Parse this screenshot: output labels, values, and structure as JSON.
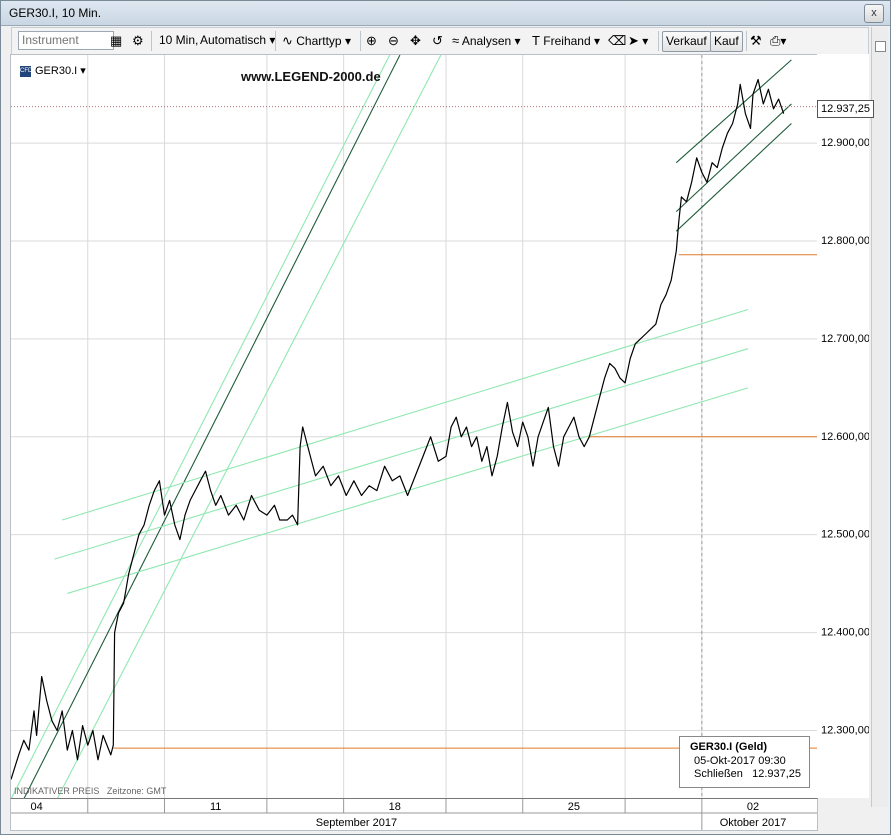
{
  "window": {
    "title": "GER30.I, 10 Min.",
    "close_label": "x"
  },
  "toolbar": {
    "instrument_placeholder": "Instrument",
    "interval_label": "10 Min,",
    "mode_label": "Automatisch",
    "charttyp_label": "Charttyp",
    "analysen_label": "Analysen",
    "freihand_label": "Freihand",
    "verkauf_label": "Verkauf",
    "kauf_label": "Kauf"
  },
  "chart_header": {
    "symbol": "GER30.I",
    "cfd_badge": "CFD",
    "watermark": "www.LEGEND-2000.de"
  },
  "footer": {
    "price_type": "INDIKATIVER PREIS",
    "timezone": "Zeitzone: GMT"
  },
  "current_price_label": "12.937,25",
  "infobox": {
    "title": "GER30.I (Geld)",
    "datetime": "05-Okt-2017 09:30",
    "close_label": "Schließen",
    "close_value": "12.937,25"
  },
  "colors": {
    "price_line": "#000000",
    "channel_dark": "#1f5c3a",
    "channel_light": "#8fe8b0",
    "support": "#e07a2a",
    "current_dotted": "#b07070",
    "grid": "#d9d9d9"
  },
  "chart_data": {
    "type": "line",
    "instrument": "GER30.I",
    "interval": "10 Min.",
    "yticks": [
      {
        "value": 12900,
        "label": "12.900,00"
      },
      {
        "value": 12800,
        "label": "12.800,00"
      },
      {
        "value": 12700,
        "label": "12.700,00"
      },
      {
        "value": 12600,
        "label": "12.600,00"
      },
      {
        "value": 12500,
        "label": "12.500,00"
      },
      {
        "value": 12400,
        "label": "12.400,00"
      },
      {
        "value": 12300,
        "label": "12.300,00"
      }
    ],
    "ylim": [
      12230,
      12990
    ],
    "xlim": [
      0,
      31.5
    ],
    "xticks": [
      {
        "t": 1.0,
        "label": "04"
      },
      {
        "t": 8.0,
        "label": "11"
      },
      {
        "t": 15.0,
        "label": "18"
      },
      {
        "t": 22.0,
        "label": "25"
      },
      {
        "t": 29.0,
        "label": "02"
      }
    ],
    "month_labels": [
      {
        "t": 13.5,
        "label": "September 2017"
      },
      {
        "t": 29.0,
        "label": "Oktober 2017"
      }
    ],
    "period_separators": [
      3.0,
      6.0,
      10.0,
      13.0,
      17.0,
      20.0,
      24.0,
      27.0
    ],
    "month_separator": 27.0,
    "current_price": 12937.25,
    "price_series": [
      [
        0.0,
        12250
      ],
      [
        0.3,
        12275
      ],
      [
        0.5,
        12290
      ],
      [
        0.7,
        12280
      ],
      [
        0.9,
        12320
      ],
      [
        1.0,
        12295
      ],
      [
        1.2,
        12355
      ],
      [
        1.4,
        12330
      ],
      [
        1.6,
        12310
      ],
      [
        1.8,
        12300
      ],
      [
        2.0,
        12320
      ],
      [
        2.2,
        12280
      ],
      [
        2.4,
        12300
      ],
      [
        2.6,
        12270
      ],
      [
        2.8,
        12305
      ],
      [
        3.0,
        12285
      ],
      [
        3.2,
        12300
      ],
      [
        3.4,
        12270
      ],
      [
        3.6,
        12295
      ],
      [
        3.9,
        12275
      ],
      [
        4.0,
        12285
      ],
      [
        4.05,
        12400
      ],
      [
        4.2,
        12420
      ],
      [
        4.4,
        12430
      ],
      [
        4.6,
        12460
      ],
      [
        4.8,
        12480
      ],
      [
        5.0,
        12500
      ],
      [
        5.2,
        12510
      ],
      [
        5.4,
        12530
      ],
      [
        5.6,
        12545
      ],
      [
        5.8,
        12555
      ],
      [
        6.0,
        12520
      ],
      [
        6.2,
        12535
      ],
      [
        6.4,
        12510
      ],
      [
        6.6,
        12495
      ],
      [
        6.8,
        12520
      ],
      [
        7.0,
        12535
      ],
      [
        7.2,
        12545
      ],
      [
        7.4,
        12555
      ],
      [
        7.6,
        12565
      ],
      [
        7.8,
        12545
      ],
      [
        8.0,
        12530
      ],
      [
        8.2,
        12540
      ],
      [
        8.5,
        12520
      ],
      [
        8.8,
        12530
      ],
      [
        9.1,
        12515
      ],
      [
        9.4,
        12540
      ],
      [
        9.7,
        12525
      ],
      [
        10.0,
        12520
      ],
      [
        10.3,
        12530
      ],
      [
        10.5,
        12515
      ],
      [
        10.8,
        12515
      ],
      [
        11.0,
        12520
      ],
      [
        11.2,
        12510
      ],
      [
        11.3,
        12590
      ],
      [
        11.4,
        12610
      ],
      [
        11.6,
        12590
      ],
      [
        11.9,
        12560
      ],
      [
        12.2,
        12570
      ],
      [
        12.5,
        12550
      ],
      [
        12.8,
        12560
      ],
      [
        13.1,
        12540
      ],
      [
        13.4,
        12555
      ],
      [
        13.7,
        12540
      ],
      [
        14.0,
        12550
      ],
      [
        14.3,
        12545
      ],
      [
        14.6,
        12570
      ],
      [
        14.9,
        12555
      ],
      [
        15.2,
        12560
      ],
      [
        15.5,
        12540
      ],
      [
        15.8,
        12560
      ],
      [
        16.1,
        12580
      ],
      [
        16.4,
        12600
      ],
      [
        16.7,
        12575
      ],
      [
        17.0,
        12580
      ],
      [
        17.2,
        12610
      ],
      [
        17.4,
        12620
      ],
      [
        17.6,
        12600
      ],
      [
        17.8,
        12610
      ],
      [
        18.0,
        12590
      ],
      [
        18.2,
        12600
      ],
      [
        18.4,
        12575
      ],
      [
        18.6,
        12590
      ],
      [
        18.8,
        12560
      ],
      [
        19.0,
        12580
      ],
      [
        19.2,
        12610
      ],
      [
        19.4,
        12635
      ],
      [
        19.6,
        12605
      ],
      [
        19.8,
        12590
      ],
      [
        20.0,
        12615
      ],
      [
        20.2,
        12600
      ],
      [
        20.4,
        12570
      ],
      [
        20.6,
        12600
      ],
      [
        20.8,
        12615
      ],
      [
        21.0,
        12630
      ],
      [
        21.2,
        12590
      ],
      [
        21.4,
        12570
      ],
      [
        21.6,
        12600
      ],
      [
        21.8,
        12610
      ],
      [
        22.0,
        12620
      ],
      [
        22.2,
        12600
      ],
      [
        22.4,
        12590
      ],
      [
        22.6,
        12600
      ],
      [
        22.8,
        12620
      ],
      [
        23.0,
        12640
      ],
      [
        23.2,
        12660
      ],
      [
        23.4,
        12675
      ],
      [
        23.6,
        12670
      ],
      [
        23.8,
        12660
      ],
      [
        24.0,
        12655
      ],
      [
        24.2,
        12680
      ],
      [
        24.4,
        12695
      ],
      [
        24.6,
        12700
      ],
      [
        24.8,
        12705
      ],
      [
        25.0,
        12710
      ],
      [
        25.2,
        12715
      ],
      [
        25.4,
        12735
      ],
      [
        25.6,
        12745
      ],
      [
        25.8,
        12760
      ],
      [
        26.0,
        12790
      ],
      [
        26.1,
        12820
      ],
      [
        26.2,
        12845
      ],
      [
        26.4,
        12840
      ],
      [
        26.6,
        12860
      ],
      [
        26.8,
        12885
      ],
      [
        27.0,
        12870
      ],
      [
        27.2,
        12860
      ],
      [
        27.4,
        12880
      ],
      [
        27.6,
        12875
      ],
      [
        27.8,
        12895
      ],
      [
        28.0,
        12910
      ],
      [
        28.2,
        12920
      ],
      [
        28.4,
        12940
      ],
      [
        28.5,
        12960
      ],
      [
        28.7,
        12930
      ],
      [
        28.9,
        12915
      ],
      [
        29.0,
        12950
      ],
      [
        29.2,
        12965
      ],
      [
        29.4,
        12940
      ],
      [
        29.6,
        12955
      ],
      [
        29.8,
        12935
      ],
      [
        30.0,
        12945
      ],
      [
        30.2,
        12930
      ]
    ],
    "trend_lines": [
      {
        "style": "dark",
        "p1": [
          0.5,
          12230
        ],
        "p2": [
          15.2,
          12990
        ]
      },
      {
        "style": "light",
        "p1": [
          0.0,
          12230
        ],
        "p2": [
          14.8,
          12990
        ]
      },
      {
        "style": "light",
        "p1": [
          1.8,
          12230
        ],
        "p2": [
          16.8,
          12990
        ]
      },
      {
        "style": "light",
        "p1": [
          2.0,
          12515
        ],
        "p2": [
          28.8,
          12730
        ]
      },
      {
        "style": "light",
        "p1": [
          1.7,
          12475
        ],
        "p2": [
          28.8,
          12690
        ]
      },
      {
        "style": "light",
        "p1": [
          2.2,
          12440
        ],
        "p2": [
          28.8,
          12650
        ]
      },
      {
        "style": "dark",
        "p1": [
          26.0,
          12880
        ],
        "p2": [
          30.5,
          12985
        ]
      },
      {
        "style": "dark",
        "p1": [
          26.0,
          12830
        ],
        "p2": [
          30.5,
          12940
        ]
      },
      {
        "style": "dark",
        "p1": [
          26.0,
          12810
        ],
        "p2": [
          30.5,
          12920
        ]
      }
    ],
    "support_lines": [
      {
        "y": 12282,
        "t1": 4.0,
        "t2": 31.5
      },
      {
        "y": 12600,
        "t1": 22.6,
        "t2": 31.5
      },
      {
        "y": 12786,
        "t1": 26.1,
        "t2": 31.5
      }
    ]
  }
}
